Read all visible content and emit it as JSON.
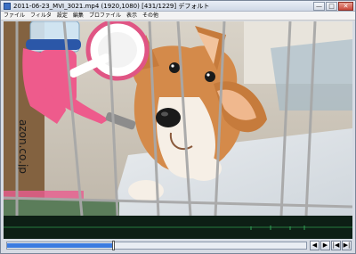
{
  "window": {
    "title": "2011-06-23_MVI_3021.mp4 (1920,1080)  [431/1229]  デフォルト",
    "buttons": {
      "minimize": "—",
      "maximize": "□",
      "close": "✕"
    }
  },
  "menu": {
    "items": [
      "ファイル",
      "フィルタ",
      "設定",
      "編集",
      "プロファイル",
      "表示",
      "その他"
    ]
  },
  "video": {
    "frame_label": "",
    "box_text": "azon.co.jp"
  },
  "playback": {
    "current_frame": 431,
    "total_frames": 1229,
    "progress": 0.35
  },
  "controls": {
    "play_label": "▶",
    "back_label": "◀",
    "start_label": "|◀",
    "end_label": "▶|"
  },
  "colors": {
    "accent": "#3c7be0",
    "audio": "#1a4d2a"
  }
}
